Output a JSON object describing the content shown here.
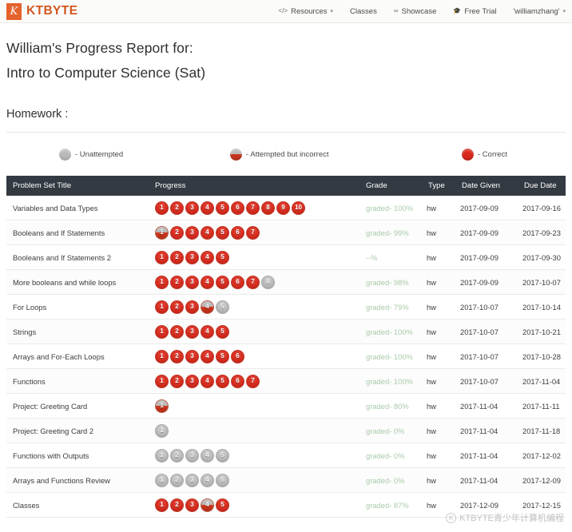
{
  "navbar": {
    "brand_mark": "K",
    "brand_name": "KTBYTE",
    "items": [
      {
        "label": "Resources",
        "icon": "code-icon",
        "icon_glyph": "</>",
        "caret": "▾"
      },
      {
        "label": "Classes",
        "icon": "",
        "icon_glyph": "",
        "caret": ""
      },
      {
        "label": "Showcase",
        "icon": "glasses-icon",
        "icon_glyph": "∞",
        "caret": ""
      },
      {
        "label": "Free Trial",
        "icon": "graduation-cap-icon",
        "icon_glyph": "🎓",
        "caret": ""
      },
      {
        "label": "'williamzhang'",
        "icon": "",
        "icon_glyph": "",
        "caret": "▾"
      }
    ]
  },
  "page": {
    "title_line1": "William's Progress Report for:",
    "title_line2": "Intro to Computer Science (Sat)",
    "section_heading": "Homework :"
  },
  "legend": {
    "unattempted": {
      "state": "gray",
      "label": "- Unattempted"
    },
    "attempted": {
      "state": "half",
      "label": "- Attempted but incorrect"
    },
    "correct": {
      "state": "red",
      "label": "- Correct"
    }
  },
  "table": {
    "columns": [
      "Problem Set Title",
      "Progress",
      "Grade",
      "Type",
      "Date Given",
      "Due Date"
    ],
    "rows": [
      {
        "title": "Variables and Data Types",
        "progress": [
          "red",
          "red",
          "red",
          "red",
          "red",
          "red",
          "red",
          "red",
          "red",
          "red"
        ],
        "grade": "graded- 100%",
        "type": "hw",
        "date_given": "2017-09-09",
        "due_date": "2017-09-16"
      },
      {
        "title": "Booleans and If Statements",
        "progress": [
          "half",
          "red",
          "red",
          "red",
          "red",
          "red",
          "red"
        ],
        "grade": "graded- 99%",
        "type": "hw",
        "date_given": "2017-09-09",
        "due_date": "2017-09-23"
      },
      {
        "title": "Booleans and If Statements 2",
        "progress": [
          "red",
          "red",
          "red",
          "red",
          "red"
        ],
        "grade": "--%",
        "type": "hw",
        "date_given": "2017-09-09",
        "due_date": "2017-09-30"
      },
      {
        "title": "More booleans and while loops",
        "progress": [
          "red",
          "red",
          "red",
          "red",
          "red",
          "red",
          "red",
          "gray"
        ],
        "grade": "graded- 98%",
        "type": "hw",
        "date_given": "2017-09-09",
        "due_date": "2017-10-07"
      },
      {
        "title": "For Loops",
        "progress": [
          "red",
          "red",
          "red",
          "half",
          "gray"
        ],
        "grade": "graded- 79%",
        "type": "hw",
        "date_given": "2017-10-07",
        "due_date": "2017-10-14"
      },
      {
        "title": "Strings",
        "progress": [
          "red",
          "red",
          "red",
          "red",
          "red"
        ],
        "grade": "graded- 100%",
        "type": "hw",
        "date_given": "2017-10-07",
        "due_date": "2017-10-21"
      },
      {
        "title": "Arrays and For-Each Loops",
        "progress": [
          "red",
          "red",
          "red",
          "red",
          "red",
          "red"
        ],
        "grade": "graded- 100%",
        "type": "hw",
        "date_given": "2017-10-07",
        "due_date": "2017-10-28"
      },
      {
        "title": "Functions",
        "progress": [
          "red",
          "red",
          "red",
          "red",
          "red",
          "red",
          "red"
        ],
        "grade": "graded- 100%",
        "type": "hw",
        "date_given": "2017-10-07",
        "due_date": "2017-11-04"
      },
      {
        "title": "Project: Greeting Card",
        "progress": [
          "half"
        ],
        "grade": "graded- 80%",
        "type": "hw",
        "date_given": "2017-11-04",
        "due_date": "2017-11-11"
      },
      {
        "title": "Project: Greeting Card 2",
        "progress": [
          "gray"
        ],
        "grade": "graded- 0%",
        "type": "hw",
        "date_given": "2017-11-04",
        "due_date": "2017-11-18"
      },
      {
        "title": "Functions with Outputs",
        "progress": [
          "gray",
          "gray",
          "gray",
          "gray",
          "gray"
        ],
        "grade": "graded- 0%",
        "type": "hw",
        "date_given": "2017-11-04",
        "due_date": "2017-12-02"
      },
      {
        "title": "Arrays and Functions Review",
        "progress": [
          "gray",
          "gray",
          "gray",
          "gray",
          "gray"
        ],
        "grade": "graded- 0%",
        "type": "hw",
        "date_given": "2017-11-04",
        "due_date": "2017-12-09"
      },
      {
        "title": "Classes",
        "progress": [
          "red",
          "red",
          "red",
          "half",
          "red"
        ],
        "grade": "graded- 87%",
        "type": "hw",
        "date_given": "2017-12-09",
        "due_date": "2017-12-15"
      }
    ]
  },
  "watermark": {
    "text": "KTBYTE青少年计算机编程",
    "logo": "K"
  },
  "colors": {
    "brand_orange": "#d2561f",
    "correct_red": "#d9261c",
    "unattempted_gray": "#b9b9b9",
    "grade_green": "#a9cba9",
    "header_dark": "#333a42"
  }
}
